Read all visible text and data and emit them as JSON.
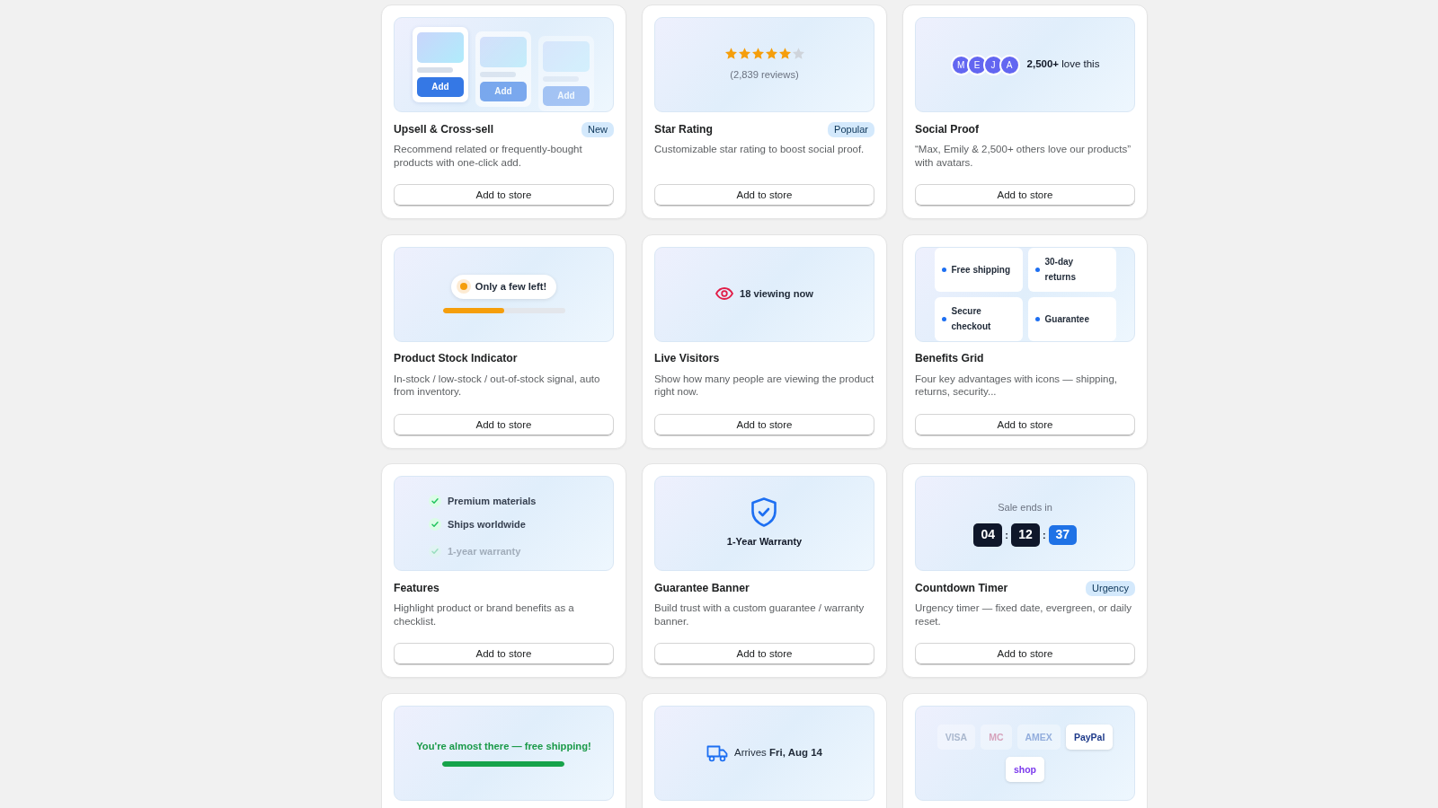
{
  "cards": [
    {
      "title": "Upsell & Cross-sell",
      "badge": "New",
      "description": "Recommend related or frequently-bought products with one-click add.",
      "button": "Add to store",
      "preview": {
        "kind": "upsell",
        "products": [
          {
            "button": "Add",
            "selected": true
          },
          {
            "button": "Add",
            "selected": false
          },
          {
            "button": "Add",
            "selected": false
          }
        ]
      }
    },
    {
      "title": "Star Rating",
      "badge": "Popular",
      "description": "Customizable star rating to boost social proof.",
      "button": "Add to store",
      "preview": {
        "kind": "stars",
        "stars": 5,
        "caption": "(2,839 reviews)"
      }
    },
    {
      "title": "Social Proof",
      "description": "“Max, Emily & 2,500+ others love our products” with avatars.",
      "button": "Add to store",
      "preview": {
        "kind": "avatars",
        "avatars": [
          "M",
          "E",
          "J",
          "A"
        ],
        "caption": "**2,500+** love this"
      }
    },
    {
      "title": "Product Stock Indicator",
      "description": "In-stock / low-stock / out-of-stock signal, auto from inventory.",
      "button": "Add to store",
      "preview": {
        "kind": "stock",
        "label": "Only a few left!",
        "level": 0.5
      }
    },
    {
      "title": "Live Visitors",
      "description": "Show how many people are viewing the product right now.",
      "button": "Add to store",
      "preview": {
        "kind": "visitors",
        "label": "18 viewing now"
      }
    },
    {
      "title": "Benefits Grid",
      "description": "Four key advantages with icons — shipping, returns, security...",
      "button": "Add to store",
      "preview": {
        "kind": "benefits",
        "items": [
          "Free shipping",
          "30-day returns",
          "Secure checkout",
          "Guarantee"
        ]
      }
    },
    {
      "title": "Features",
      "description": "Highlight product or brand benefits as a checklist.",
      "button": "Add to store",
      "preview": {
        "kind": "checklist",
        "items": [
          {
            "text": "Premium materials",
            "faded": false
          },
          {
            "text": "Ships worldwide",
            "faded": false
          },
          {
            "text": "1-year warranty",
            "faded": true
          }
        ]
      }
    },
    {
      "title": "Guarantee Banner",
      "description": "Build trust with a custom guarantee / warranty banner.",
      "button": "Add to store",
      "preview": {
        "kind": "guarantee",
        "label": "1-Year Warranty"
      }
    },
    {
      "title": "Countdown Timer",
      "badge": "Urgency",
      "description": "Urgency timer — fixed date, evergreen, or daily reset.",
      "button": "Add to store",
      "preview": {
        "kind": "countdown",
        "caption": "Sale ends in",
        "separators": [
          ":",
          ":"
        ],
        "segments": [
          {
            "value": "04",
            "highlight": false
          },
          {
            "value": "12",
            "highlight": false
          },
          {
            "value": "37",
            "highlight": true
          }
        ]
      }
    },
    {
      "preview": {
        "kind": "shipping_bar",
        "label": "You're almost there — free shipping!",
        "level": 1
      }
    },
    {
      "preview": {
        "kind": "delivery",
        "label": "Arrives **Fri, Aug 14**"
      }
    },
    {
      "preview": {
        "kind": "payments",
        "methods": [
          {
            "label": "VISA",
            "color": "#aab8ce",
            "faded": true
          },
          {
            "label": "MC",
            "color": "#d6a3bc",
            "faded": true
          },
          {
            "label": "AMEX",
            "color": "#93aedd",
            "faded": true
          },
          {
            "label": "PayPal",
            "color": "#1e3a8a",
            "faded": false
          },
          {
            "label": "shop",
            "color": "#7c3aed",
            "faded": false
          }
        ]
      }
    }
  ]
}
